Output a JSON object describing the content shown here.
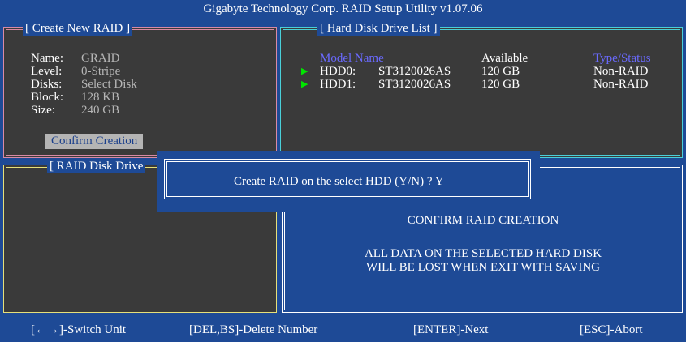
{
  "title": "Gigabyte Technology Corp.  RAID Setup Utility  v1.07.06",
  "create_panel": {
    "title": "[ Create New RAID ]",
    "fields": [
      {
        "label": "Name:",
        "value": "GRAID"
      },
      {
        "label": "Level:",
        "value": "0-Stripe"
      },
      {
        "label": "Disks:",
        "value": "Select Disk"
      },
      {
        "label": "Block:",
        "value": "128 KB"
      },
      {
        "label": "Size:",
        "value": "240 GB"
      }
    ],
    "confirm_button": "Confirm Creation"
  },
  "hdd_panel": {
    "title": "[ Hard Disk Drive List ]",
    "headers": {
      "model": "Model Name",
      "available": "Available",
      "type": "Type/Status"
    },
    "rows": [
      {
        "port": "HDD0:",
        "model": "ST3120026AS",
        "available": "120 GB",
        "type": "Non-RAID"
      },
      {
        "port": "HDD1:",
        "model": "ST3120026AS",
        "available": "120 GB",
        "type": "Non-RAID"
      }
    ]
  },
  "raid_panel": {
    "title": "[ RAID Disk Drive"
  },
  "dialog": {
    "prompt": "Create RAID on the select HDD (Y/N) ? Y"
  },
  "warning": {
    "heading": "CONFIRM RAID CREATION",
    "line1": "ALL DATA ON THE SELECTED HARD DISK",
    "line2": "WILL BE LOST WHEN EXIT WITH SAVING"
  },
  "status": {
    "switch": "[←→]-Switch Unit",
    "delete": "[DEL,BS]-Delete Number",
    "next": "[ENTER]-Next",
    "abort": "[ESC]-Abort"
  },
  "colors": {
    "background": "#1e4a96",
    "panel": "#3a3a3a",
    "create_border": "#d98aa6",
    "hdd_border": "#4ad0d8",
    "raid_border": "#e6e07a"
  }
}
